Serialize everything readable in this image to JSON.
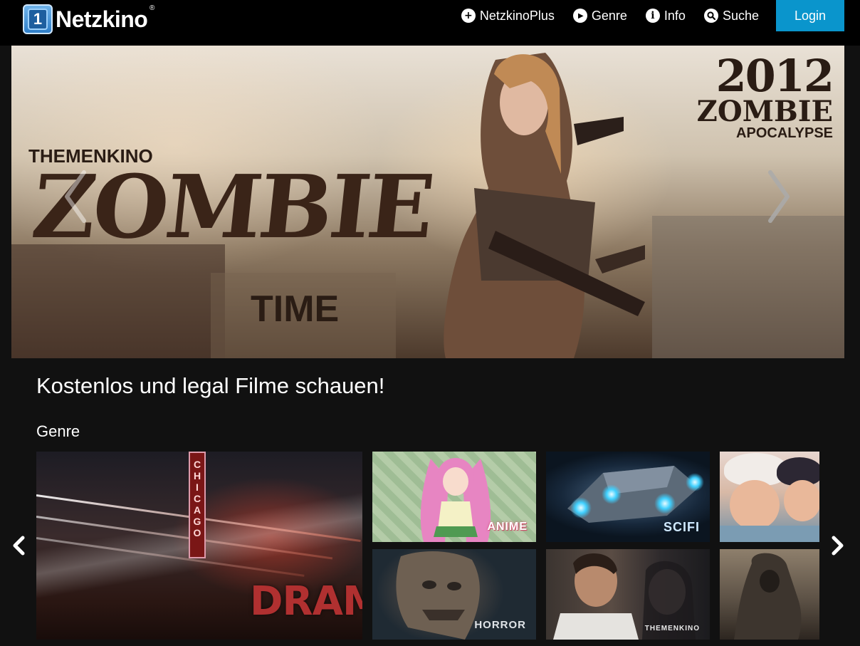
{
  "brand": {
    "name": "Netzkino",
    "badge_number": "1",
    "registered": "®"
  },
  "nav": {
    "items": [
      {
        "label": "NetzkinoPlus",
        "icon": "plus-circle-icon",
        "glyph": "+"
      },
      {
        "label": "Genre",
        "icon": "play-circle-icon",
        "glyph": "▶"
      },
      {
        "label": "Info",
        "icon": "info-circle-icon",
        "glyph": "i"
      },
      {
        "label": "Suche",
        "icon": "search-icon",
        "glyph": "⚲"
      }
    ],
    "login_label": "Login",
    "accent": "#0a95cc"
  },
  "hero": {
    "left_overline": "THEMENKINO",
    "left_title": "ZOMBIE",
    "left_subtitle": "TIME",
    "right_year": "2012",
    "right_title": "ZOMBIE",
    "right_subtitle": "APOCALYPSE"
  },
  "main": {
    "tagline": "Kostenlos und legal Filme schauen!",
    "genre_heading": "Genre"
  },
  "genres": {
    "drama": {
      "label": "DRAMA",
      "sign": [
        "C",
        "H",
        "I",
        "C",
        "A",
        "G",
        "O"
      ]
    },
    "anime": {
      "label": "ANIME"
    },
    "scifi": {
      "label": "SCIFI"
    },
    "horror": {
      "label": "HORROR"
    },
    "themenkino": {
      "label": "THEMENKINO"
    }
  }
}
